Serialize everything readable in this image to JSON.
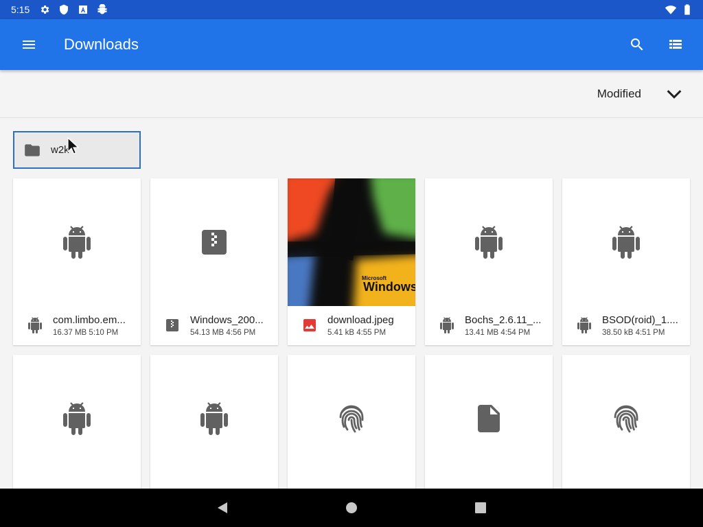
{
  "status_bar": {
    "time": "5:15",
    "icons": [
      "settings-icon",
      "shield-icon",
      "a-icon",
      "android-debug-icon"
    ],
    "right_icons": [
      "wifi-icon",
      "battery-icon"
    ]
  },
  "app_bar": {
    "title": "Downloads",
    "menu_icon": "menu-icon",
    "search_icon": "search-icon",
    "view_icon": "list-view-icon",
    "color": "#2174e8"
  },
  "sort": {
    "label": "Modified",
    "icon": "chevron-down-icon"
  },
  "folder": {
    "name": "w2k",
    "icon": "folder-icon"
  },
  "files": [
    {
      "name": "com.limbo.em...",
      "info": "16.37 MB 5:10 PM",
      "type": "apk"
    },
    {
      "name": "Windows_200...",
      "info": "54.13 MB 4:56 PM",
      "type": "zip"
    },
    {
      "name": "download.jpeg",
      "info": "5.41 kB 4:55 PM",
      "type": "image"
    },
    {
      "name": "Bochs_2.6.11_...",
      "info": "13.41 MB 4:54 PM",
      "type": "apk"
    },
    {
      "name": "BSOD(roid)_1....",
      "info": "38.50 kB 4:51 PM",
      "type": "apk"
    },
    {
      "name": "",
      "info": "",
      "type": "apk"
    },
    {
      "name": "",
      "info": "",
      "type": "apk"
    },
    {
      "name": "",
      "info": "",
      "type": "fingerprint"
    },
    {
      "name": "",
      "info": "",
      "type": "document"
    },
    {
      "name": "",
      "info": "",
      "type": "fingerprint"
    }
  ],
  "image_thumbnail": {
    "text": "Windows",
    "subtext": "Microsoft"
  },
  "nav_bar": {
    "back_icon": "back-icon",
    "home_icon": "home-icon",
    "recents_icon": "recents-icon"
  }
}
